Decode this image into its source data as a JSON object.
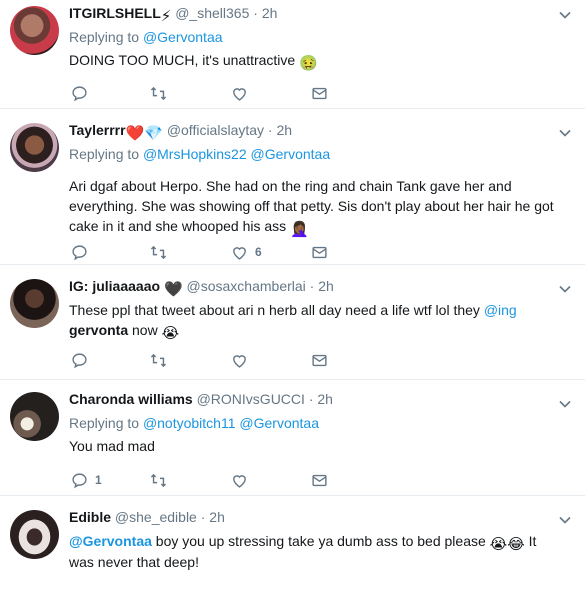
{
  "colors": {
    "link": "#1b95e0",
    "muted": "#657786",
    "border": "#e6ecf0",
    "heart_red": "#e0245e"
  },
  "tweets": [
    {
      "name": "ITGIRLSHELL",
      "name_emoji": "⚡",
      "handle": "@_shell365",
      "sep": "·",
      "time": "2h",
      "replying_prefix": "Replying to",
      "replying_to": [
        "@Gervontaa"
      ],
      "text": "DOING TOO MUCH, it's unattractive",
      "text_emoji": "🤢",
      "stats": {
        "reply": "",
        "retweet": "",
        "like": ""
      }
    },
    {
      "name": "Taylerrrr",
      "name_emoji": "❤️💎",
      "handle": "@officialslaytay",
      "sep": "·",
      "time": "2h",
      "replying_prefix": "Replying to",
      "replying_to": [
        "@MrsHopkins22",
        "@Gervontaa"
      ],
      "text": "Ari dgaf about Herpo. She had on the ring and chain Tank gave her and everything. She was showing off that petty. Sis don't play about her hair he got cake in it and she whooped his ass",
      "text_emoji": "🤦🏾‍♀️",
      "stats": {
        "reply": "",
        "retweet": "",
        "like": "6"
      }
    },
    {
      "name": "IG: juliaaaaao",
      "name_emoji": "🖤",
      "handle": "@sosaxchamberlai",
      "sep": "·",
      "time": "2h",
      "text": "These ppl that tweet about ari n herb all day need a life wtf lol they ",
      "text_link": "@ing",
      "text_bold": "gervonta",
      "text_tail": " now",
      "text_emoji": "😭",
      "stats": {
        "reply": "",
        "retweet": "",
        "like": ""
      }
    },
    {
      "name": "Charonda williams",
      "handle": "@RONIvsGUCCI",
      "sep": "·",
      "time": "2h",
      "replying_prefix": "Replying to",
      "replying_to": [
        "@notyobitch11",
        "@Gervontaa"
      ],
      "text": "You mad mad",
      "stats": {
        "reply": "1",
        "retweet": "",
        "like": ""
      }
    },
    {
      "name": "Edible",
      "handle": "@she_edible",
      "sep": "·",
      "time": "2h",
      "text_link": "@Gervontaa",
      "text": " boy you up stressing take ya dumb ass to bed please ",
      "text_emoji": "😭😂",
      "text_tail": " It was never that deep!",
      "stats": {
        "reply": "",
        "retweet": "",
        "like": ""
      }
    }
  ]
}
